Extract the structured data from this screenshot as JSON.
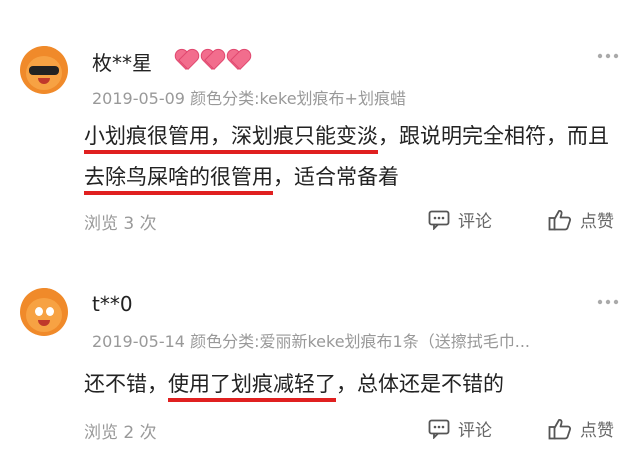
{
  "reviews": [
    {
      "username": "枚**星",
      "badge_hearts": 3,
      "date": "2019-05-09",
      "variant": "颜色分类:keke划痕布+划痕蜡",
      "content": {
        "u1": "小划痕很管用，深划痕只能变淡",
        "t1": "，跟说明完全相符，而且",
        "u2": "去除鸟屎啥的很管用",
        "t2": "，适合常备着"
      },
      "views": "浏览 3 次",
      "comment_label": "评论",
      "like_label": "点赞"
    },
    {
      "username": "t**0",
      "date": "2019-05-14",
      "variant": "颜色分类:爱丽新keke划痕布1条（送擦拭毛巾...",
      "content": {
        "t1": "还不错，",
        "u1": "使用了划痕减轻了",
        "t2": "，总体还是不错的"
      },
      "views": "浏览 2 次",
      "comment_label": "评论",
      "like_label": "点赞"
    }
  ],
  "icons": {
    "more": "more-dots-icon",
    "comment": "comment-icon",
    "like": "thumbs-up-icon",
    "badge": "heart-icon"
  },
  "colors": {
    "underline": "#e02020",
    "heart": "#f26d8d",
    "avatar": "#f08a2a"
  }
}
